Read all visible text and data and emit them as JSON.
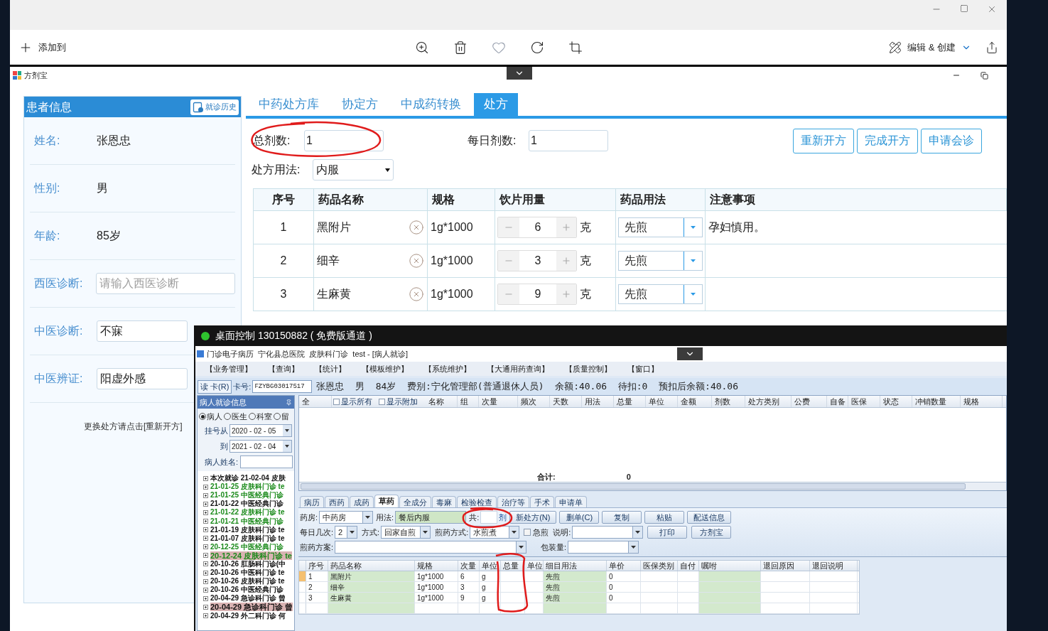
{
  "viewer": {
    "add_label": "添加到",
    "edit_label": "编辑 & 创建"
  },
  "app": {
    "title": "方剂宝"
  },
  "patient_panel": {
    "title": "患者信息",
    "history_button": "就诊历史",
    "hint": "更换处方请点击[重新开方]",
    "fields": [
      {
        "kind": "text",
        "label": "姓名:",
        "value": "张恩忠"
      },
      {
        "kind": "text",
        "label": "性别:",
        "value": "男"
      },
      {
        "kind": "text",
        "label": "年龄:",
        "value": "85岁"
      },
      {
        "kind": "input",
        "label": "西医诊断:",
        "placeholder": "请输入西医诊断"
      },
      {
        "kind": "input",
        "label": "中医诊断:",
        "value": "不寐"
      },
      {
        "kind": "input",
        "label": "中医辨证:",
        "value": "阳虚外感"
      }
    ]
  },
  "tabs": [
    {
      "label": "中药处方库",
      "selected": false
    },
    {
      "label": "协定方",
      "selected": false
    },
    {
      "label": "中成药转换",
      "selected": false
    },
    {
      "label": "处方",
      "selected": true
    }
  ],
  "prescription": {
    "total_label": "总剂数:",
    "total_value": "1",
    "daily_label": "每日剂数:",
    "daily_value": "1",
    "usage_label": "处方用法:",
    "usage_value": "内服",
    "buttons": [
      "重新开方",
      "完成开方",
      "申请会诊"
    ],
    "columns": [
      "序号",
      "药品名称",
      "规格",
      "饮片用量",
      "药品用法",
      "注意事项"
    ],
    "rows": [
      {
        "no": "1",
        "name": "黑附片",
        "spec": "1g*1000",
        "dose": "6",
        "unit": "克",
        "method": "先煎",
        "note": "孕妇慎用。"
      },
      {
        "no": "2",
        "name": "细辛",
        "spec": "1g*1000",
        "dose": "3",
        "unit": "克",
        "method": "先煎"
      },
      {
        "no": "3",
        "name": "生麻黄",
        "spec": "1g*1000",
        "dose": "9",
        "unit": "克",
        "method": "先煎"
      }
    ]
  },
  "remote": {
    "title": "桌面控制 130150882 ( 免费版通道 )",
    "app_title": "门诊电子病历  宁化县总医院  皮肤科门诊  test - [病人就诊]",
    "menu": [
      "【业务管理】",
      "【查询】",
      "【统计】",
      "【模板维护】",
      "【系统维护】",
      "【大通用药查询】",
      "【质量控制】",
      "【窗口】"
    ],
    "card_button": "读 卡(R)",
    "card_label": "卡号:",
    "card_value": "FZYBG03017517",
    "patient_line": "张恩忠  男  84岁  费别:宁化管理部(普通退休人员)  余额:40.06  待扣:0  预扣后余额:40.06",
    "left": {
      "title": "病人就诊信息",
      "radios": [
        {
          "label": "病人",
          "selected": true
        },
        {
          "label": "医生",
          "selected": false
        },
        {
          "label": "科室",
          "selected": false
        },
        {
          "label": "留",
          "selected": false
        }
      ],
      "from_label": "挂号从",
      "from_value": "2020 - 02 - 05",
      "to_label": "到",
      "to_value": "2021 - 02 - 04",
      "name_label": "病人姓名:",
      "visits": [
        {
          "text": "本次就诊 21-02-04 皮肤",
          "color": "#111111",
          "highlighted": false
        },
        {
          "text": "21-01-25 皮肤科门诊 te",
          "color": "#1a8a1a",
          "highlighted": false
        },
        {
          "text": "21-01-25 中医经典门诊",
          "color": "#1a8a1a",
          "highlighted": false
        },
        {
          "text": "21-01-22 中医经典门诊",
          "color": "#111111",
          "highlighted": false
        },
        {
          "text": "21-01-22 皮肤科门诊 te",
          "color": "#1a8a1a",
          "highlighted": false
        },
        {
          "text": "21-01-21 中医经典门诊",
          "color": "#1a8a1a",
          "highlighted": false
        },
        {
          "text": "21-01-19 皮肤科门诊 te",
          "color": "#111111",
          "highlighted": false
        },
        {
          "text": "21-01-07 皮肤科门诊 te",
          "color": "#111111",
          "highlighted": false
        },
        {
          "text": "20-12-25 中医经典门诊",
          "color": "#1a8a1a",
          "highlighted": false
        },
        {
          "text": "20-12-24 皮肤科门诊 te",
          "color": "#1a8a1a",
          "highlighted": true
        },
        {
          "text": "20-10-26 肛肠科门诊(中",
          "color": "#111111",
          "highlighted": false
        },
        {
          "text": "20-10-26 中医科门诊 te",
          "color": "#111111",
          "highlighted": false
        },
        {
          "text": "20-10-26 皮肤科门诊 te",
          "color": "#111111",
          "highlighted": false
        },
        {
          "text": "20-10-26 中医经典门诊",
          "color": "#111111",
          "highlighted": false
        },
        {
          "text": "20-04-29 急诊科门诊 曾",
          "color": "#111111",
          "highlighted": false
        },
        {
          "text": "20-04-29 急诊科门诊 曾",
          "color": "#111111",
          "highlighted": true
        },
        {
          "text": "20-04-29 外二科门诊 何",
          "color": "#111111",
          "highlighted": false
        }
      ]
    },
    "upper_grid": {
      "columns": [
        {
          "kind": "text",
          "label": "全"
        },
        {
          "kind": "checkbox",
          "label": "显示所有",
          "checked": false
        },
        {
          "kind": "checkbox",
          "label": "显示附加",
          "checked": false
        },
        {
          "kind": "text",
          "label": "名称"
        },
        {
          "kind": "text",
          "label": "组"
        },
        {
          "kind": "text",
          "label": "次量"
        },
        {
          "kind": "text",
          "label": "频次"
        },
        {
          "kind": "text",
          "label": "天数"
        },
        {
          "kind": "text",
          "label": "用法"
        },
        {
          "kind": "text",
          "label": "总量"
        },
        {
          "kind": "text",
          "label": "单位"
        },
        {
          "kind": "text",
          "label": "金额"
        },
        {
          "kind": "text",
          "label": "剂数"
        },
        {
          "kind": "text",
          "label": "处方类别"
        },
        {
          "kind": "text",
          "label": "公费"
        },
        {
          "kind": "text",
          "label": "自备"
        },
        {
          "kind": "text",
          "label": "医保"
        },
        {
          "kind": "text",
          "label": "状态"
        },
        {
          "kind": "text",
          "label": "冲销数量"
        },
        {
          "kind": "text",
          "label": "规格"
        }
      ],
      "total_label": "合计:",
      "total_value": "0"
    },
    "tabs": [
      {
        "label": "病历",
        "selected": false
      },
      {
        "label": "西药",
        "selected": false
      },
      {
        "label": "成药",
        "selected": false
      },
      {
        "label": "草药",
        "selected": true
      },
      {
        "label": "全成分",
        "selected": false
      },
      {
        "label": "毒麻",
        "selected": false
      },
      {
        "label": "检验检查",
        "selected": false
      },
      {
        "label": "治疗等",
        "selected": false
      },
      {
        "label": "手术",
        "selected": false
      },
      {
        "label": "申请单",
        "selected": false
      }
    ],
    "form": {
      "lines": [
        {
          "items": [
            {
              "kind": "dropdown",
              "label": "药房:",
              "value": "中药房"
            },
            {
              "kind": "input",
              "label": "用法:",
              "value": "餐后内服"
            },
            {
              "kind": "count",
              "label": "共:",
              "suffix": "剂"
            },
            {
              "kind": "button",
              "label": "新处方(N)"
            },
            {
              "kind": "button",
              "label": "删单(C)"
            },
            {
              "kind": "button",
              "label": "复制"
            },
            {
              "kind": "button",
              "label": "粘贴"
            },
            {
              "kind": "button",
              "label": "配送信息"
            }
          ]
        },
        {
          "items": [
            {
              "kind": "dropdown",
              "label": "每日几次:",
              "value": "2"
            },
            {
              "kind": "dropdown",
              "label": "方式:",
              "value": "回家自煎"
            },
            {
              "kind": "dropdown",
              "label": "煎药方式:",
              "value": "水煎煮"
            },
            {
              "kind": "checkbox",
              "label": "急煎",
              "checked": false
            },
            {
              "kind": "dropdown",
              "label": "说明:"
            },
            {
              "kind": "button",
              "label": "打印"
            },
            {
              "kind": "button",
              "label": "方剂宝"
            }
          ]
        },
        {
          "items": [
            {
              "kind": "dropdown",
              "label": "煎药方案:"
            },
            {
              "kind": "dropdown",
              "label": "包装量:"
            }
          ]
        }
      ]
    },
    "lower_grid": {
      "columns": [
        "序号",
        "药品名称",
        "规格",
        "次量",
        "单位",
        "总量",
        "单位",
        "细目用法",
        "单价",
        "医保类别",
        "自付",
        "嘱咐",
        "退回原因",
        "退回说明"
      ],
      "rows": [
        [
          "1",
          "黑附片",
          "1g*1000",
          "6",
          "g",
          "",
          "",
          "先煎",
          "0",
          "",
          "",
          "",
          "",
          ""
        ],
        [
          "2",
          "细辛",
          "1g*1000",
          "3",
          "g",
          "",
          "",
          "先煎",
          "0",
          "",
          "",
          "",
          "",
          ""
        ],
        [
          "3",
          "生麻黄",
          "1g*1000",
          "9",
          "g",
          "",
          "",
          "先煎",
          "0",
          "",
          "",
          "",
          "",
          ""
        ]
      ]
    }
  }
}
